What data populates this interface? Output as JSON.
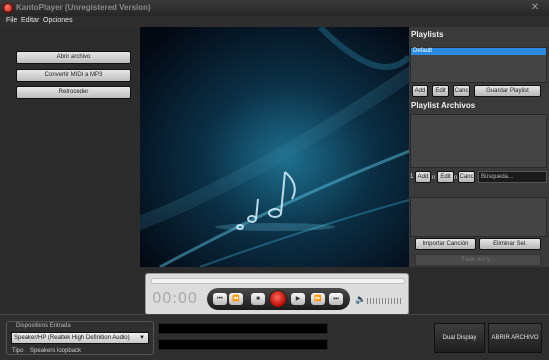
{
  "window": {
    "title": "KantoPlayer (Unregistered Version)",
    "close_glyph": "✕"
  },
  "menu": [
    "File",
    "Editar",
    "Opciones"
  ],
  "left": {
    "buttons": [
      "Abrir archivo",
      "Convertir MIDI a MP3",
      "Retroceder"
    ]
  },
  "right": {
    "playlists_heading": "Playlists",
    "selected_playlist": "Default",
    "playlist_buttons": [
      "Add",
      "Edit",
      "Canc"
    ],
    "save_button": "Guardar Playlist",
    "files_heading": "Playlist Archivos",
    "file_index": "1",
    "file_buttons": [
      "Add",
      "Edit",
      "Canc"
    ],
    "file_separator": "n",
    "search_placeholder": "Búsqueda...",
    "import_button": "Importar Canción",
    "remove_button": "Eliminar Sel.",
    "fade_label": "Fade out y..."
  },
  "player": {
    "time": "00:00",
    "transport": [
      "⏮",
      "⏪",
      "■",
      "▶",
      "⏩",
      "⏭"
    ],
    "volume_icon": "speaker-icon"
  },
  "bottom": {
    "group_label": "Dispositivos Entrada",
    "input_device": "Speaker/HP (Realtek High Definition Audio)",
    "tipo_label": "Tipo",
    "tipo_value": "Speakers loopback",
    "dual_display": "Dual Display",
    "open_file": "ABRIR ARCHIVO"
  },
  "colors": {
    "accent": "#2a8be0",
    "record": "#c0120a",
    "background": "#2b2b2b"
  }
}
